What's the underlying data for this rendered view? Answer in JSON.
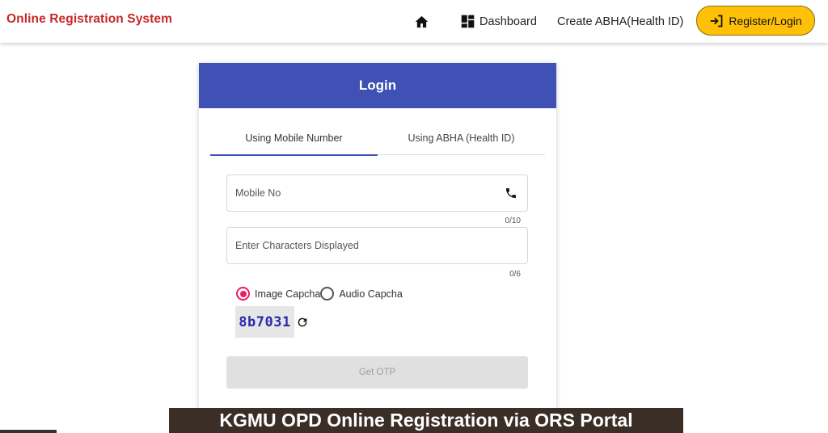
{
  "header": {
    "brand": "Online Registration System",
    "nav": {
      "home_icon": "home-icon",
      "dashboard_label": "Dashboard",
      "abha_label": "Create ABHA(Health ID)",
      "register_label": "Register/Login"
    }
  },
  "login": {
    "title": "Login",
    "tabs": [
      {
        "label": "Using Mobile Number",
        "active": true
      },
      {
        "label": "Using ABHA (Health ID)",
        "active": false
      }
    ],
    "mobile": {
      "placeholder": "Mobile No",
      "value": "",
      "counter": "0/10"
    },
    "captcha_input": {
      "placeholder": "Enter Characters Displayed",
      "value": "",
      "counter": "0/6"
    },
    "captcha_options": [
      {
        "label": "Image Capcha",
        "selected": true
      },
      {
        "label": "Audio Capcha",
        "selected": false
      }
    ],
    "captcha_text": "8b7031",
    "otp_button": "Get OTP"
  },
  "banner": {
    "text": "KGMU OPD Online Registration via ORS Portal"
  },
  "colors": {
    "brand": "#c62828",
    "header_blue": "#3f51b5",
    "register_yellow": "#ffc107",
    "radio_pink": "#e91e63",
    "banner_bg": "#3b2e27"
  }
}
